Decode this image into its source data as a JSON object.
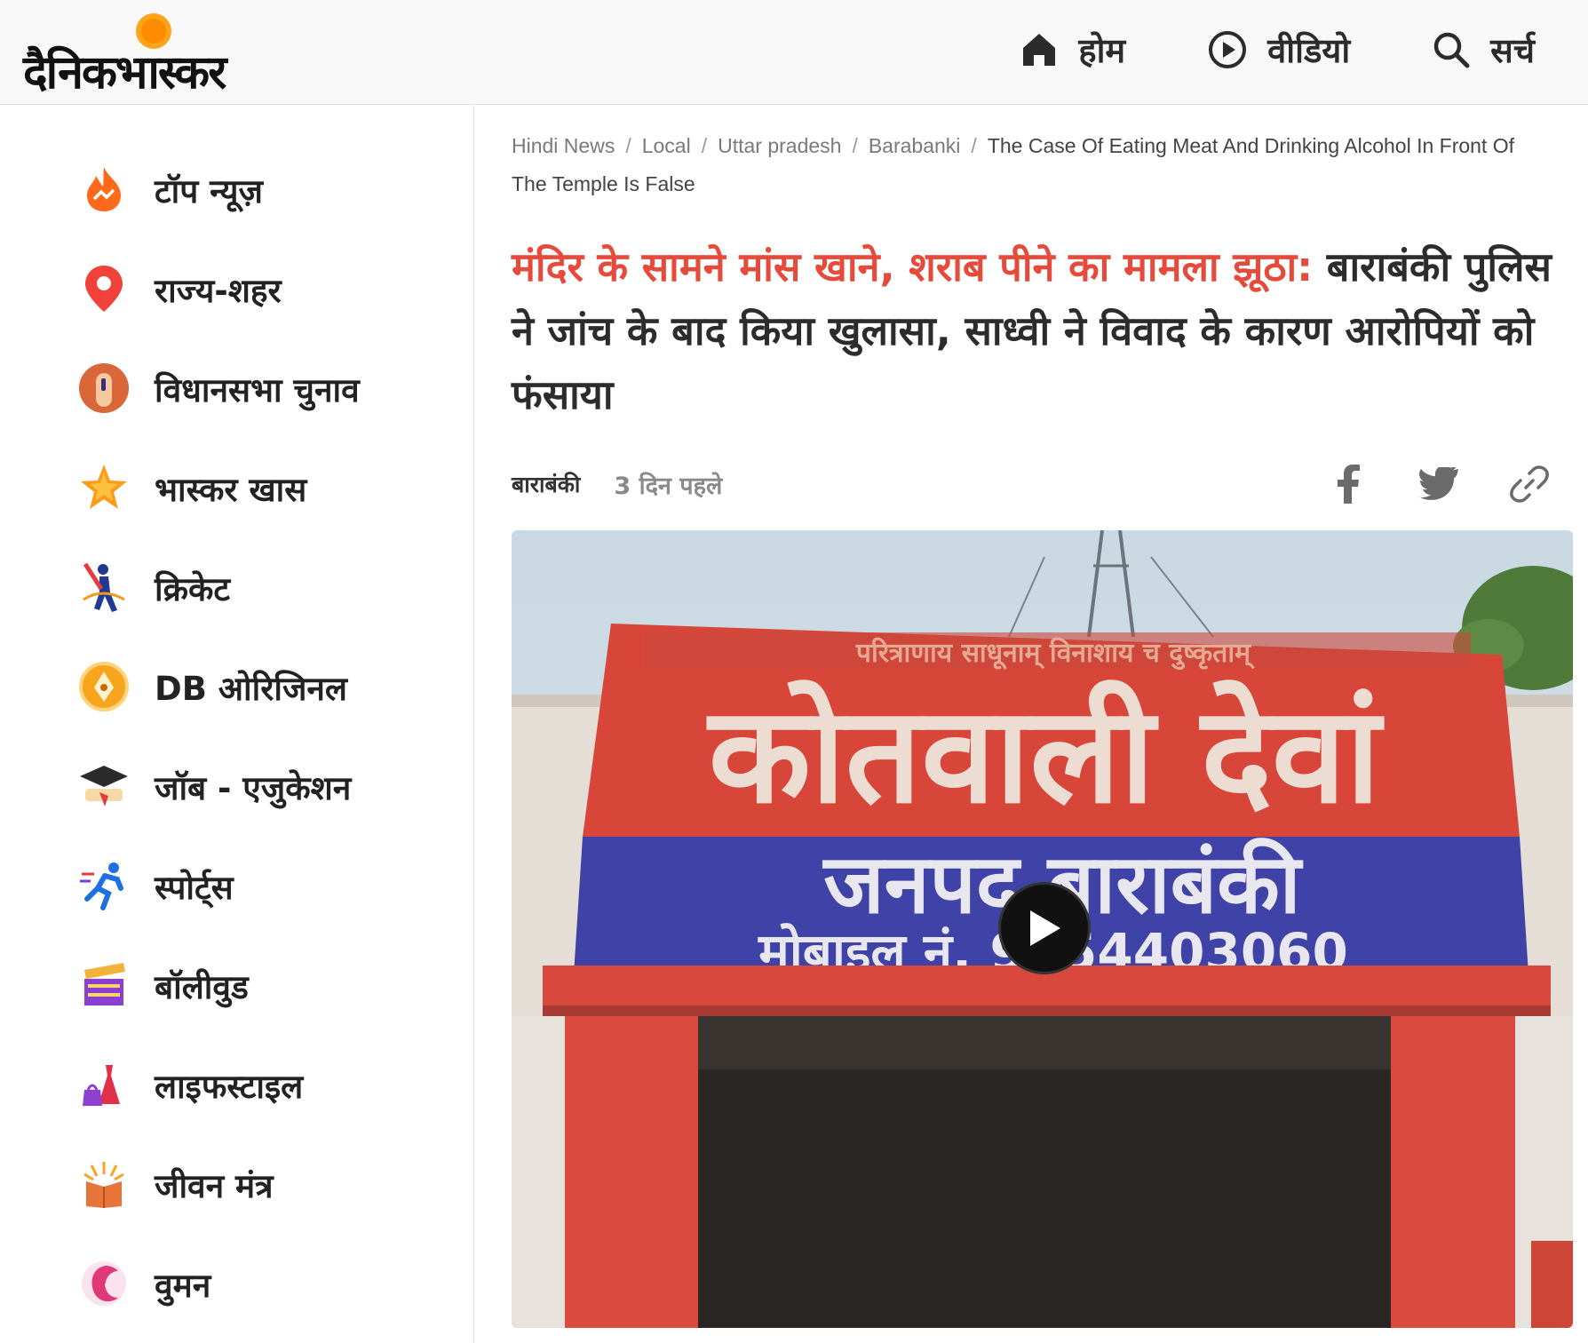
{
  "header": {
    "logo_text": "दैनिकभास्कर",
    "nav": [
      {
        "label": "होम",
        "icon": "home-icon"
      },
      {
        "label": "वीडियो",
        "icon": "play-circle-icon"
      },
      {
        "label": "सर्च",
        "icon": "search-icon"
      }
    ]
  },
  "sidebar": {
    "items": [
      {
        "label": "टॉप न्यूज़",
        "icon": "fire-icon"
      },
      {
        "label": "राज्य-शहर",
        "icon": "location-pin-icon"
      },
      {
        "label": "विधानसभा चुनाव",
        "icon": "voting-finger-icon"
      },
      {
        "label": "भास्कर खास",
        "icon": "star-icon"
      },
      {
        "label": "क्रिकेट",
        "icon": "cricket-icon"
      },
      {
        "label": "DB ओरिजिनल",
        "icon": "pen-nib-icon"
      },
      {
        "label": "जॉब - एजुकेशन",
        "icon": "graduation-cap-icon"
      },
      {
        "label": "स्पोर्ट्स",
        "icon": "runner-icon"
      },
      {
        "label": "बॉलीवुड",
        "icon": "clapperboard-icon"
      },
      {
        "label": "लाइफस्टाइल",
        "icon": "dress-bag-icon"
      },
      {
        "label": "जीवन मंत्र",
        "icon": "book-icon"
      },
      {
        "label": "वुमन",
        "icon": "woman-icon"
      }
    ]
  },
  "breadcrumb": {
    "items": [
      "Hindi News",
      "Local",
      "Uttar pradesh",
      "Barabanki"
    ],
    "current": "The Case Of Eating Meat And Drinking Alcohol In Front Of The Temple Is False"
  },
  "article": {
    "headline_highlight": "मंदिर के सामने मांस खाने, शराब पीने का मामला झूठा:",
    "headline_rest": " बाराबंकी पुलिस ने जांच के बाद किया खुलासा, साध्वी ने विवाद के कारण आरोपियों को फंसाया",
    "city": "बाराबंकी",
    "time": "3 दिन पहले",
    "share": [
      "facebook-icon",
      "twitter-icon",
      "link-icon"
    ],
    "image": {
      "sign_line1": "कोतवाली देवां",
      "sign_line2": "जनपद बाराबंकी",
      "sign_line3": "मोबाइल नं. 9454403060",
      "top_strip": "परित्राणाय साधूनाम् विनाशाय च दुष्कृताम्"
    }
  },
  "colors": {
    "accent_red": "#e64a3a",
    "sign_red": "#d8463a",
    "sign_blue": "#3f42a6"
  }
}
